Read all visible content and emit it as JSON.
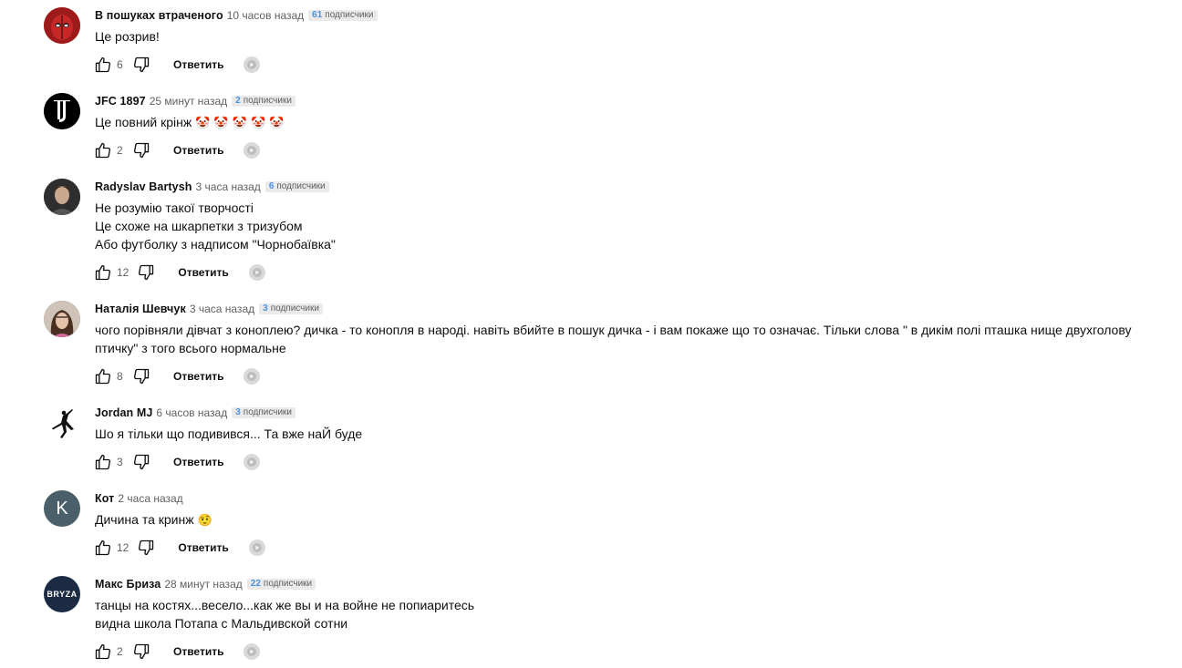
{
  "comments": [
    {
      "author": "В пошуках втраченого",
      "time": "10 часов назад",
      "subs_num": "61",
      "subs_label": "подписчики",
      "lines": "Це розрив!",
      "likes": "6",
      "reply": "Ответить",
      "avatar": "deadpool-avatar",
      "avatar_color": "#b3261e"
    },
    {
      "author": "JFC 1897",
      "time": "25 минут назад",
      "subs_num": "2",
      "subs_label": "подписчики",
      "lines": "Це повний крінж",
      "emojis": "🤡 🤡 🤡 🤡 🤡",
      "likes": "2",
      "reply": "Ответить",
      "avatar": "juventus-logo-avatar",
      "avatar_color": "#000000"
    },
    {
      "author": "Radyslav Bartysh",
      "time": "3 часа назад",
      "subs_num": "6",
      "subs_label": "подписчики",
      "lines": "Не розумію такої творчості\nЦе схоже на шкарпетки з тризубом\nАбо футболку з надписом \"Чорнобаївка\"",
      "likes": "12",
      "reply": "Ответить",
      "avatar": "man-photo-avatar",
      "avatar_color": "#3a3a3a"
    },
    {
      "author": "Наталія Шевчук",
      "time": "3 часа назад",
      "subs_num": "3",
      "subs_label": "подписчики",
      "lines": "чого порівняли дівчат з коноплею? дичка - то конопля в народі. навіть вбийте в пошук дичка - і вам покаже що то означає.  Тільки слова \" в дикім полі пташка нище двухголову птичку\" з того всього нормальне",
      "likes": "8",
      "reply": "Ответить",
      "avatar": "woman-photo-avatar",
      "avatar_color": "#8a6a5a"
    },
    {
      "author": "Jordan MJ",
      "time": "6 часов назад",
      "subs_num": "3",
      "subs_label": "подписчики",
      "lines": "Шо я тільки що подивився... Та вже наЙ буде",
      "likes": "3",
      "reply": "Ответить",
      "avatar": "jumpman-logo-avatar",
      "avatar_color": "#ffffff"
    },
    {
      "author": "Кот",
      "time": "2 часа назад",
      "lines": "Дичина та кринж",
      "emojis": "🤨",
      "likes": "12",
      "reply": "Ответить",
      "avatar": "letter-avatar",
      "avatar_letter": "K",
      "avatar_color": "#4b5f6a"
    },
    {
      "author": "Макс Бриза",
      "time": "28 минут назад",
      "subs_num": "22",
      "subs_label": "подписчики",
      "lines": "танцы на костях...весело...как же вы и на войне не попиаритесь\nвидна школа Потапа с Мальдивской сотни",
      "likes": "2",
      "reply": "Ответить",
      "avatar": "bryza-logo-avatar",
      "avatar_text": "BRYZA",
      "avatar_color": "#1d2a44"
    }
  ]
}
